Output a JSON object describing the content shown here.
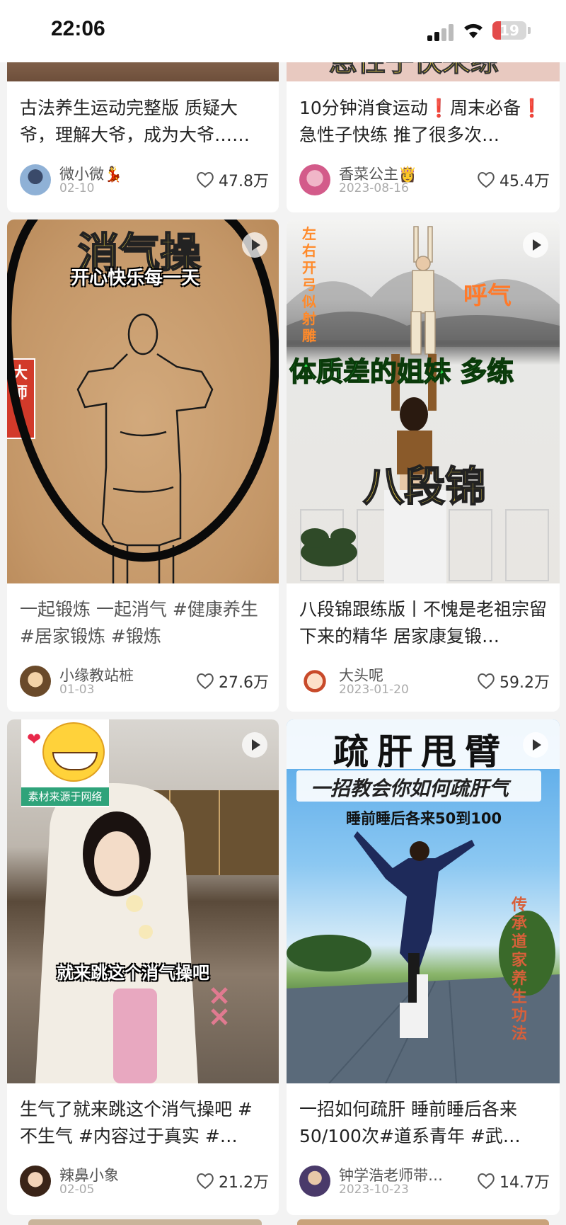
{
  "status_bar": {
    "time": "22:06",
    "battery": "19"
  },
  "cards": [
    {
      "title": "古法养生运动完整版 质疑大爷，理解大爷，成为大爷……",
      "author": "微小微💃",
      "date": "02-10",
      "likes": "47.8万"
    },
    {
      "title": "10分钟消食运动❗周末必备❗急性子快练 推了很多次…",
      "author": "香菜公主👸",
      "date": "2023-08-16",
      "likes": "45.4万",
      "overlay": "急性子快来练"
    },
    {
      "title": "一起锻炼 一起消气 #健康养生  #居家锻炼  #锻炼",
      "author": "小缘教站桩",
      "date": "01-03",
      "likes": "27.6万",
      "overlay_title": "消气操",
      "overlay_sub": "开心快乐每一天",
      "side_tag": "大师"
    },
    {
      "title": "八段锦跟练版丨不愧是老祖宗留下来的精华 居家康复锻…",
      "author": "大头呢",
      "date": "2023-01-20",
      "likes": "59.2万",
      "overlay_side": "左右开弓似射雕",
      "overlay_breath": "呼气",
      "overlay_mid": "体质差的姐妹 多练",
      "overlay_big": "八段锦"
    },
    {
      "title": "生气了就来跳这个消气操吧 #不生气  #内容过于真实  #…",
      "author": "辣鼻小象",
      "date": "02-05",
      "likes": "21.2万",
      "overlay_caption": "就来跳这个消气操吧",
      "overlay_source": "素材来源于网络"
    },
    {
      "title": "一招如何疏肝 睡前睡后各来50/100次#道系青年  #武…",
      "author": "钟学浩老师带…",
      "date": "2023-10-23",
      "likes": "14.7万",
      "overlay_title": "疏肝甩臂",
      "overlay_sub": "一招教会你如何疏肝气",
      "overlay_sub2": "睡前睡后各来50到100",
      "overlay_side": "传承道家养生功法"
    }
  ],
  "colors": {
    "accent_yellow": "#ffe14a",
    "accent_green": "#27e04a",
    "accent_orange": "#ff8a2a"
  }
}
